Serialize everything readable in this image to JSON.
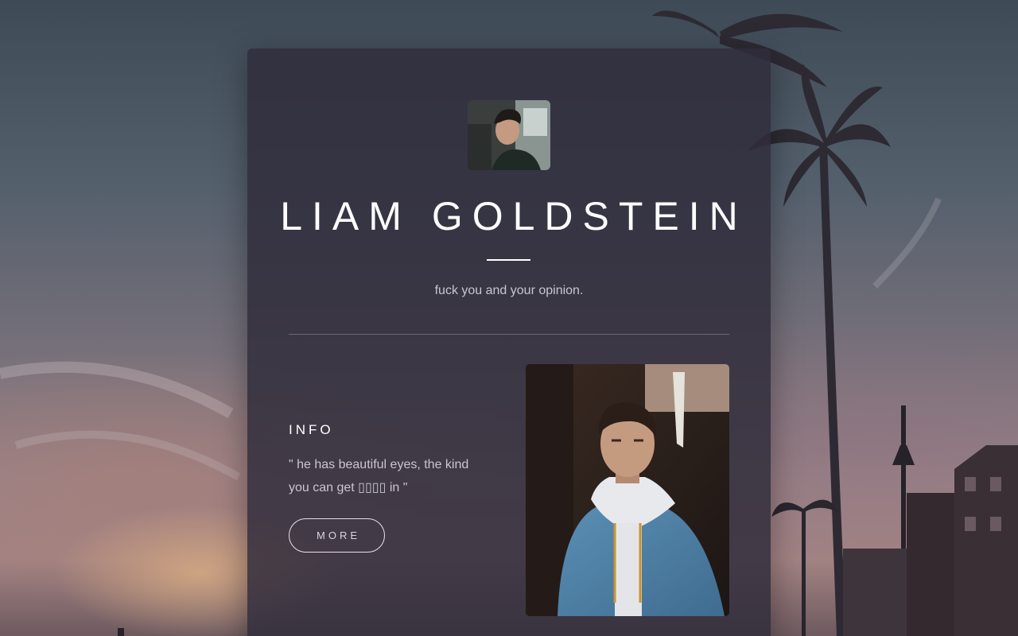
{
  "profile": {
    "name": "LIAM GOLDSTEIN",
    "tagline": "fuck you and your opinion."
  },
  "info": {
    "heading": "INFO",
    "line1": "\" he has beautiful eyes, the kind",
    "line2": "you can get ▯▯▯▯ in \""
  },
  "actions": {
    "more_label": "MORE"
  },
  "colors": {
    "card_background": "#302c3a",
    "text_primary": "#ffffff",
    "text_secondary": "#c9c5cf"
  },
  "icons": {
    "avatar": "avatar-photo",
    "feature_photo": "portrait-photo"
  }
}
